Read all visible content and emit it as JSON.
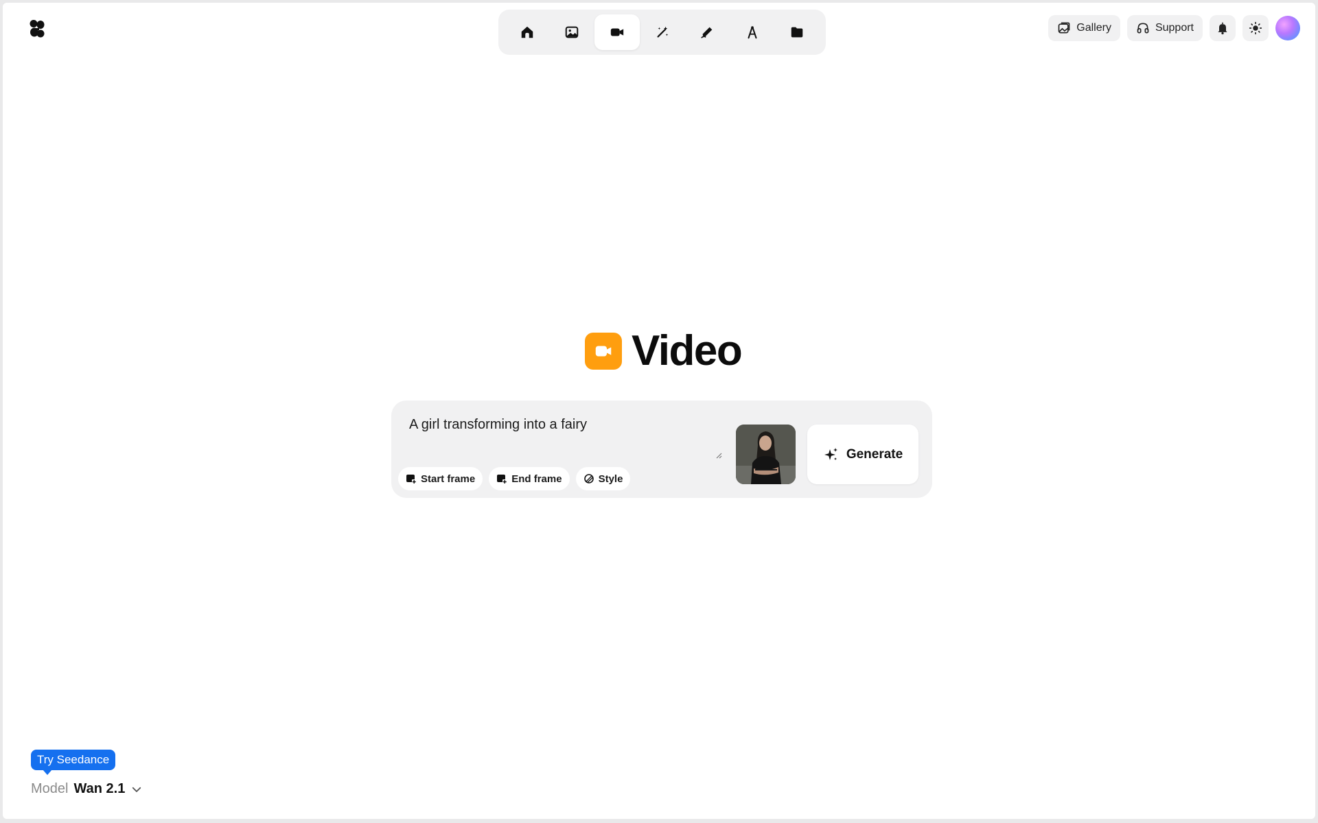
{
  "nav": {
    "items": [
      {
        "icon": "home-icon",
        "active": false
      },
      {
        "icon": "image-icon",
        "active": false
      },
      {
        "icon": "video-camera-icon",
        "active": true
      },
      {
        "icon": "magic-wand-icon",
        "active": false
      },
      {
        "icon": "pen-icon",
        "active": false
      },
      {
        "icon": "compass-icon",
        "active": false
      },
      {
        "icon": "folder-icon",
        "active": false
      }
    ]
  },
  "topright": {
    "gallery_label": "Gallery",
    "support_label": "Support"
  },
  "hero": {
    "title": "Video",
    "icon_color": "#ff9e0f"
  },
  "prompt": {
    "text": "A girl transforming into a fairy",
    "chips": {
      "start_frame": "Start frame",
      "end_frame": "End frame",
      "style": "Style"
    },
    "generate_label": "Generate"
  },
  "footer": {
    "badge": "Try Seedance",
    "badge_color": "#1570ef",
    "model_label": "Model",
    "model_value": "Wan 2.1"
  }
}
